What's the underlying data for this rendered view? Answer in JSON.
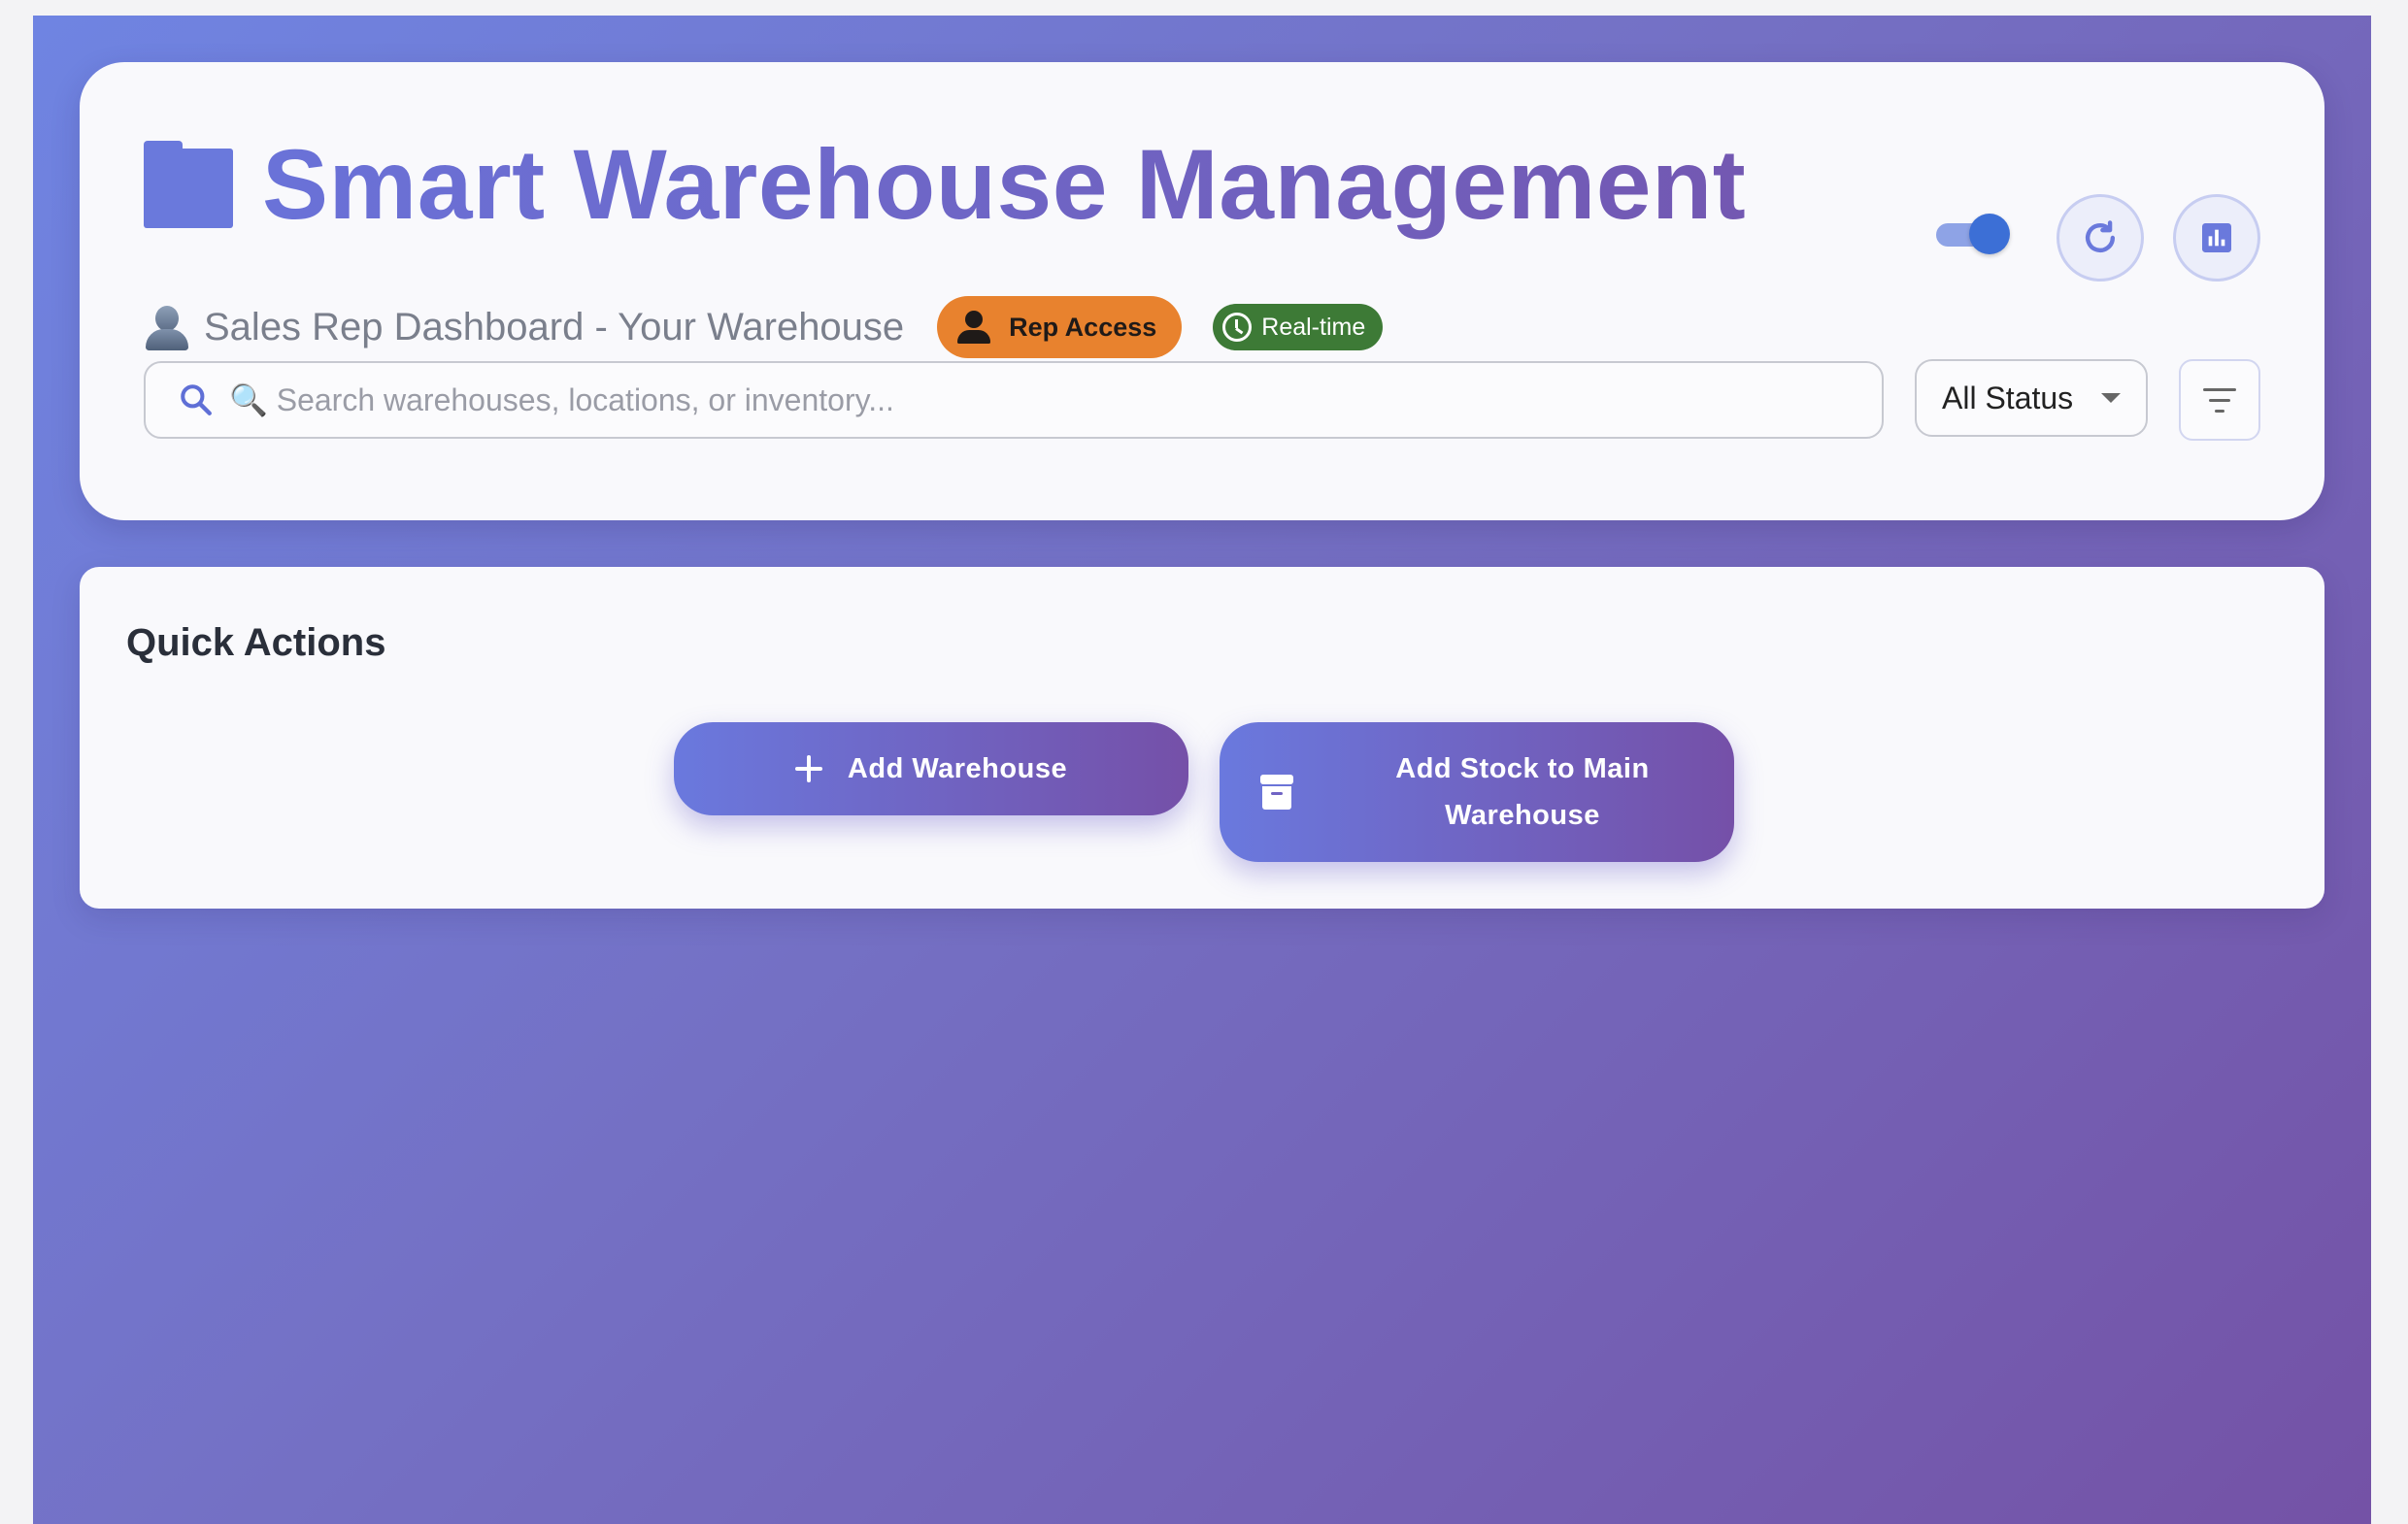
{
  "header": {
    "title": "Smart Warehouse Management",
    "subtitle": "Sales Rep Dashboard - Your Warehouse",
    "badges": {
      "rep_access": "Rep Access",
      "realtime": "Real-time"
    },
    "toggle_on": true,
    "icons": {
      "title": "folder-icon",
      "subtitle": "user-icon",
      "refresh": "refresh-icon",
      "stats": "bar-chart-icon",
      "filter": "filter-icon"
    }
  },
  "search": {
    "placeholder": "🔍 Search warehouses, locations, or inventory...",
    "value": ""
  },
  "status_filter": {
    "selected": "All Status"
  },
  "quick_actions": {
    "title": "Quick Actions",
    "add_warehouse_label": "Add Warehouse",
    "add_stock_label": "Add Stock to Main Warehouse"
  },
  "colors": {
    "accent": "#6a79de",
    "accent_end": "#7550a8",
    "rep_badge": "#e8822e",
    "realtime_badge": "#3d7a36"
  }
}
